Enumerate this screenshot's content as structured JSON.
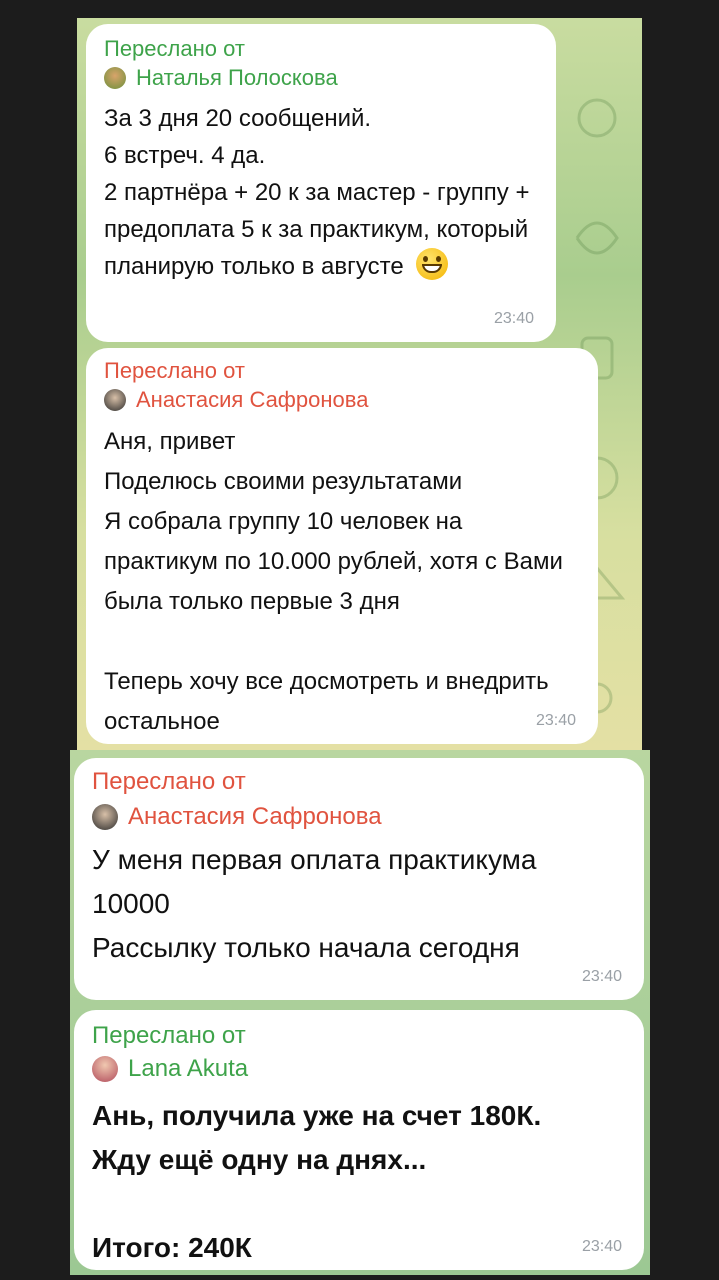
{
  "messages": [
    {
      "forwarded_label": "Переслано от",
      "author": "Наталья Полоскова",
      "author_color": "#3ea34a",
      "text": "За 3 дня 20 сообщений.\n6 встреч. 4 да.\n2 партнёра + 20 к за мастер - группу + предоплата  5 к за практикум, который планирую только  в августе",
      "emoji": "grinning-face-emoji",
      "time": "23:40"
    },
    {
      "forwarded_label": "Переслано от",
      "author": "Анастасия Сафронова",
      "author_color": "#e0533f",
      "text": "Аня, привет\nПоделюсь своими результатами\nЯ собрала группу 10 человек на практикум по 10.000 рублей, хотя с Вами была только первые 3 дня\n\nТеперь хочу все досмотреть и внедрить остальное",
      "time": "23:40"
    },
    {
      "forwarded_label": "Переслано от",
      "author": "Анастасия Сафронова",
      "author_color": "#e0533f",
      "text": "У меня первая оплата практикума\n10000\nРассылку только начала сегодня",
      "time": "23:40"
    },
    {
      "forwarded_label": "Переслано от",
      "author": "Lana Akuta",
      "author_color": "#3ea34a",
      "text": "Ань, получила уже на счет 180К.\nЖду ещё одну на днях...\n\nИтого: 240К",
      "time": "23:40"
    }
  ]
}
